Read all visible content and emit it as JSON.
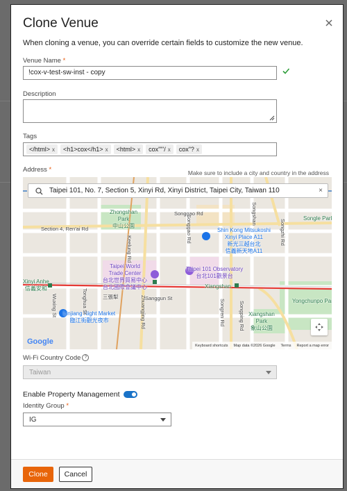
{
  "modal": {
    "title": "Clone Venue",
    "intro": "When cloning a venue, you can override certain fields to customize the new venue."
  },
  "venue_name": {
    "label": "Venue Name",
    "required_mark": "*",
    "value": "!cox-v-test-sw-inst - copy"
  },
  "description": {
    "label": "Description",
    "value": ""
  },
  "tags": {
    "label": "Tags",
    "items": [
      {
        "text": "</html>",
        "remove": "x"
      },
      {
        "text": "<h1>cox</h1>",
        "remove": "x"
      },
      {
        "text": "<html>",
        "remove": "x"
      },
      {
        "text": "cox\"\"'/",
        "remove": "x"
      },
      {
        "text": "cox\"?",
        "remove": "x"
      }
    ]
  },
  "address": {
    "label": "Address",
    "required_mark": "*",
    "hint": "Make sure to include a city and country in the address",
    "search_value": "Taipei 101, No. 7, Section 5, Xinyi Rd, Xinyi District, Taipei City, Taiwan 110",
    "clear": "×"
  },
  "map": {
    "labels": {
      "zhongshan_park": "Zhongshan\nPark",
      "zhongshan_park_zh": "中山公園",
      "songgao_rd": "Songgao Rd",
      "section4": "Section 4, Ren'ai Rd",
      "shin_kong": "Shin Kong Mitsukoshi\nXinyi Place A11",
      "shin_kong_zh": "新光三越台北\n信義新天地A11",
      "songgao_vert": "Songgao Rd",
      "songzhi_rd": "Songzhi Rd",
      "songren_rd": "Songren Rd",
      "songde_rd": "Songde Rd",
      "songle_park": "Songle Park",
      "trade_center": "Taipei World\nTrade Center",
      "trade_center_zh": "台北世界貿易中心\n台北國際會議中心",
      "observatory": "Taipei 101 Observatory",
      "observatory_zh": "台北101觀景台",
      "xinyi_anhe": "Xinyi Anhe",
      "xinyi_anhe_zh": "信義安和",
      "sanzhangli": "三張犁",
      "sanggun_st": "Sanggun St",
      "xiangshan": "Xiangshan",
      "xiangshan_zh": "象山",
      "yongchun_park": "Yongchunpo\nPark",
      "night_market": "Linjiang Night Market",
      "night_market_zh": "臨江街觀光夜市",
      "xiangshan_park": "Xiangshan\nPark",
      "xiangshan_park_zh": "象山公園",
      "tonghua": "Tonghua St",
      "zhuangjing": "Zhuangjing Rd",
      "keelung": "Keelung Rd",
      "wuxing": "Wuxing St",
      "songping": "Songping Rd",
      "songshan": "Songshan"
    },
    "google": "Google",
    "footer": [
      "Keyboard shortcuts",
      "Map data ©2026 Google",
      "Terms",
      "Report a map error"
    ]
  },
  "wifi_country": {
    "label": "Wi-Fi Country Code",
    "info": "?",
    "value": "Taiwan"
  },
  "property_management": {
    "label": "Enable Property Management",
    "enabled": true
  },
  "identity_group": {
    "label": "Identity Group",
    "required_mark": "*",
    "value": "IG"
  },
  "buttons": {
    "clone": "Clone",
    "cancel": "Cancel"
  },
  "colors": {
    "primary": "#e8650a",
    "toggle": "#1a73c8",
    "valid": "#2e9d3a"
  }
}
